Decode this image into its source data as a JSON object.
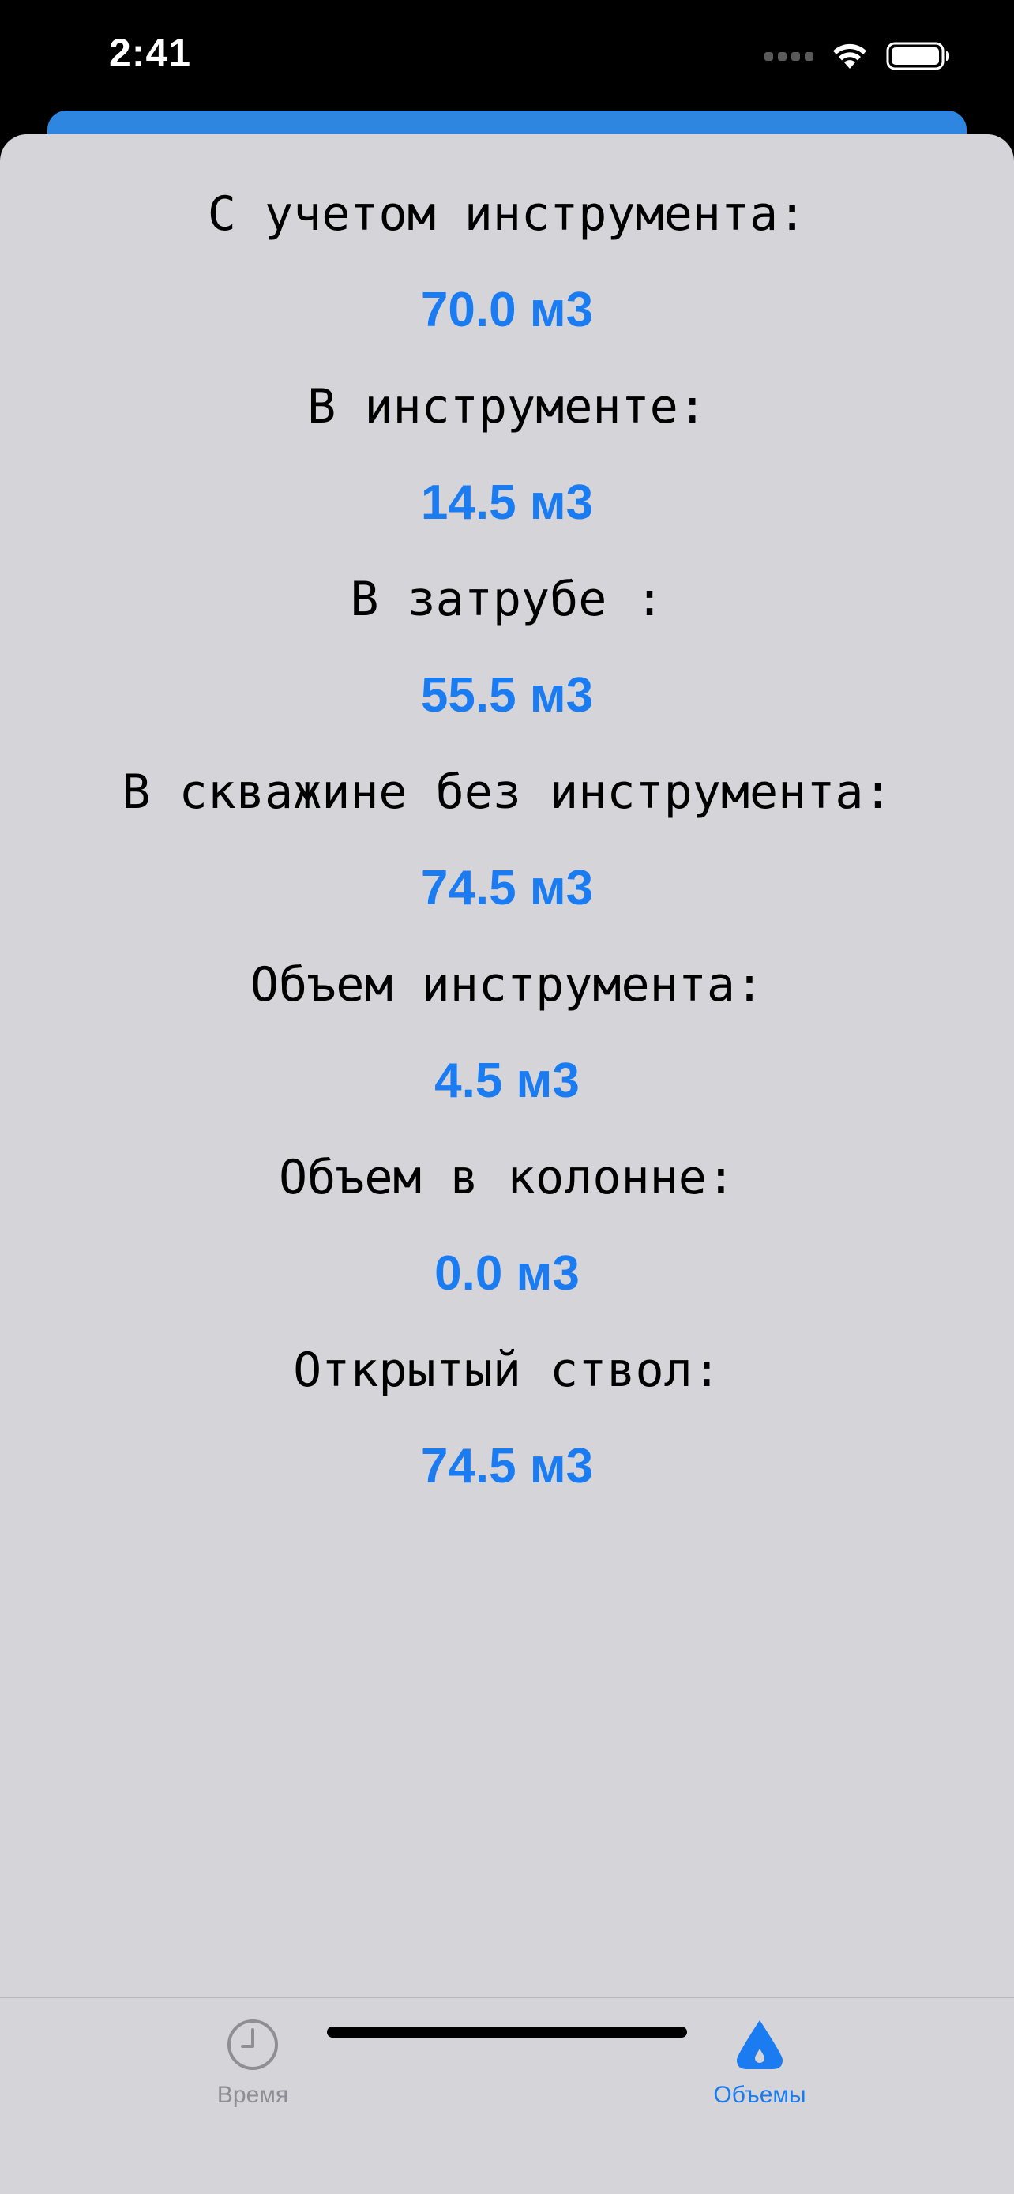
{
  "status_bar": {
    "time": "2:41"
  },
  "volumes": [
    {
      "label": "С учетом инструмента:",
      "value": "70.0 м3"
    },
    {
      "label": "В инструменте:",
      "value": "14.5 м3"
    },
    {
      "label": "В затрубе :",
      "value": "55.5 м3"
    },
    {
      "label": "В скважине без инструмента:",
      "value": "74.5 м3"
    },
    {
      "label": "Объем инструмента:",
      "value": "4.5 м3"
    },
    {
      "label": "Объем в колонне:",
      "value": "0.0 м3"
    },
    {
      "label": "Открытый ствол:",
      "value": "74.5 м3"
    }
  ],
  "tab_bar": {
    "tabs": [
      {
        "label": "Время",
        "icon": "clock-icon",
        "selected": false
      },
      {
        "label": "Объемы",
        "icon": "drop-icon",
        "selected": true
      }
    ]
  },
  "colors": {
    "accent": "#1a7cf0",
    "sheet_background": "#d4d4d9",
    "inactive_tab": "#8e8e93"
  }
}
